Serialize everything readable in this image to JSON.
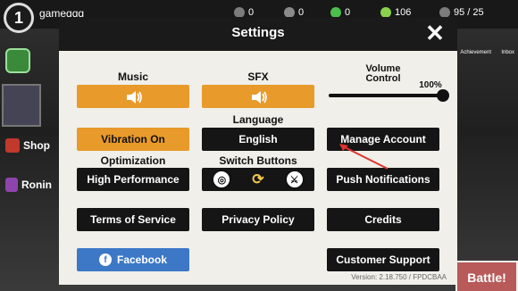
{
  "topbar": {
    "level": "1",
    "username": "gameqqq",
    "resources": [
      {
        "icon": "leaf-icon",
        "value": "0"
      },
      {
        "icon": "tool-icon",
        "value": "0"
      },
      {
        "icon": "gem-icon",
        "value": "0"
      },
      {
        "icon": "coin-icon",
        "value": "106"
      },
      {
        "icon": "energy-icon",
        "value": "95 / 25"
      }
    ]
  },
  "sidebar": {
    "shop_label": "Shop",
    "ronin_label": "Ronin"
  },
  "right": {
    "achievement_label": "Achievement",
    "inbox_label": "Inbox",
    "battle_label": "Battle!"
  },
  "modal": {
    "title": "Settings",
    "music_label": "Music",
    "sfx_label": "SFX",
    "volume_label": "Volume\nControl",
    "volume_value": "100%",
    "volume_fraction": 1.0,
    "language_label": "Language",
    "language_value": "English",
    "vibration_label": "Vibration On",
    "manage_account_label": "Manage Account",
    "optimization_label": "Optimization",
    "optimization_value": "High Performance",
    "switch_buttons_label": "Switch Buttons",
    "push_notifications_label": "Push Notifications",
    "terms_label": "Terms of Service",
    "privacy_label": "Privacy Policy",
    "credits_label": "Credits",
    "facebook_label": "Facebook",
    "support_label": "Customer Support",
    "version": "Version: 2.18.750 / FPDCBAA"
  },
  "colors": {
    "orange": "#e89a2a",
    "dark": "#151515",
    "facebook": "#3d78c7",
    "paper": "#f0efe9",
    "arrow": "#e0332e"
  }
}
